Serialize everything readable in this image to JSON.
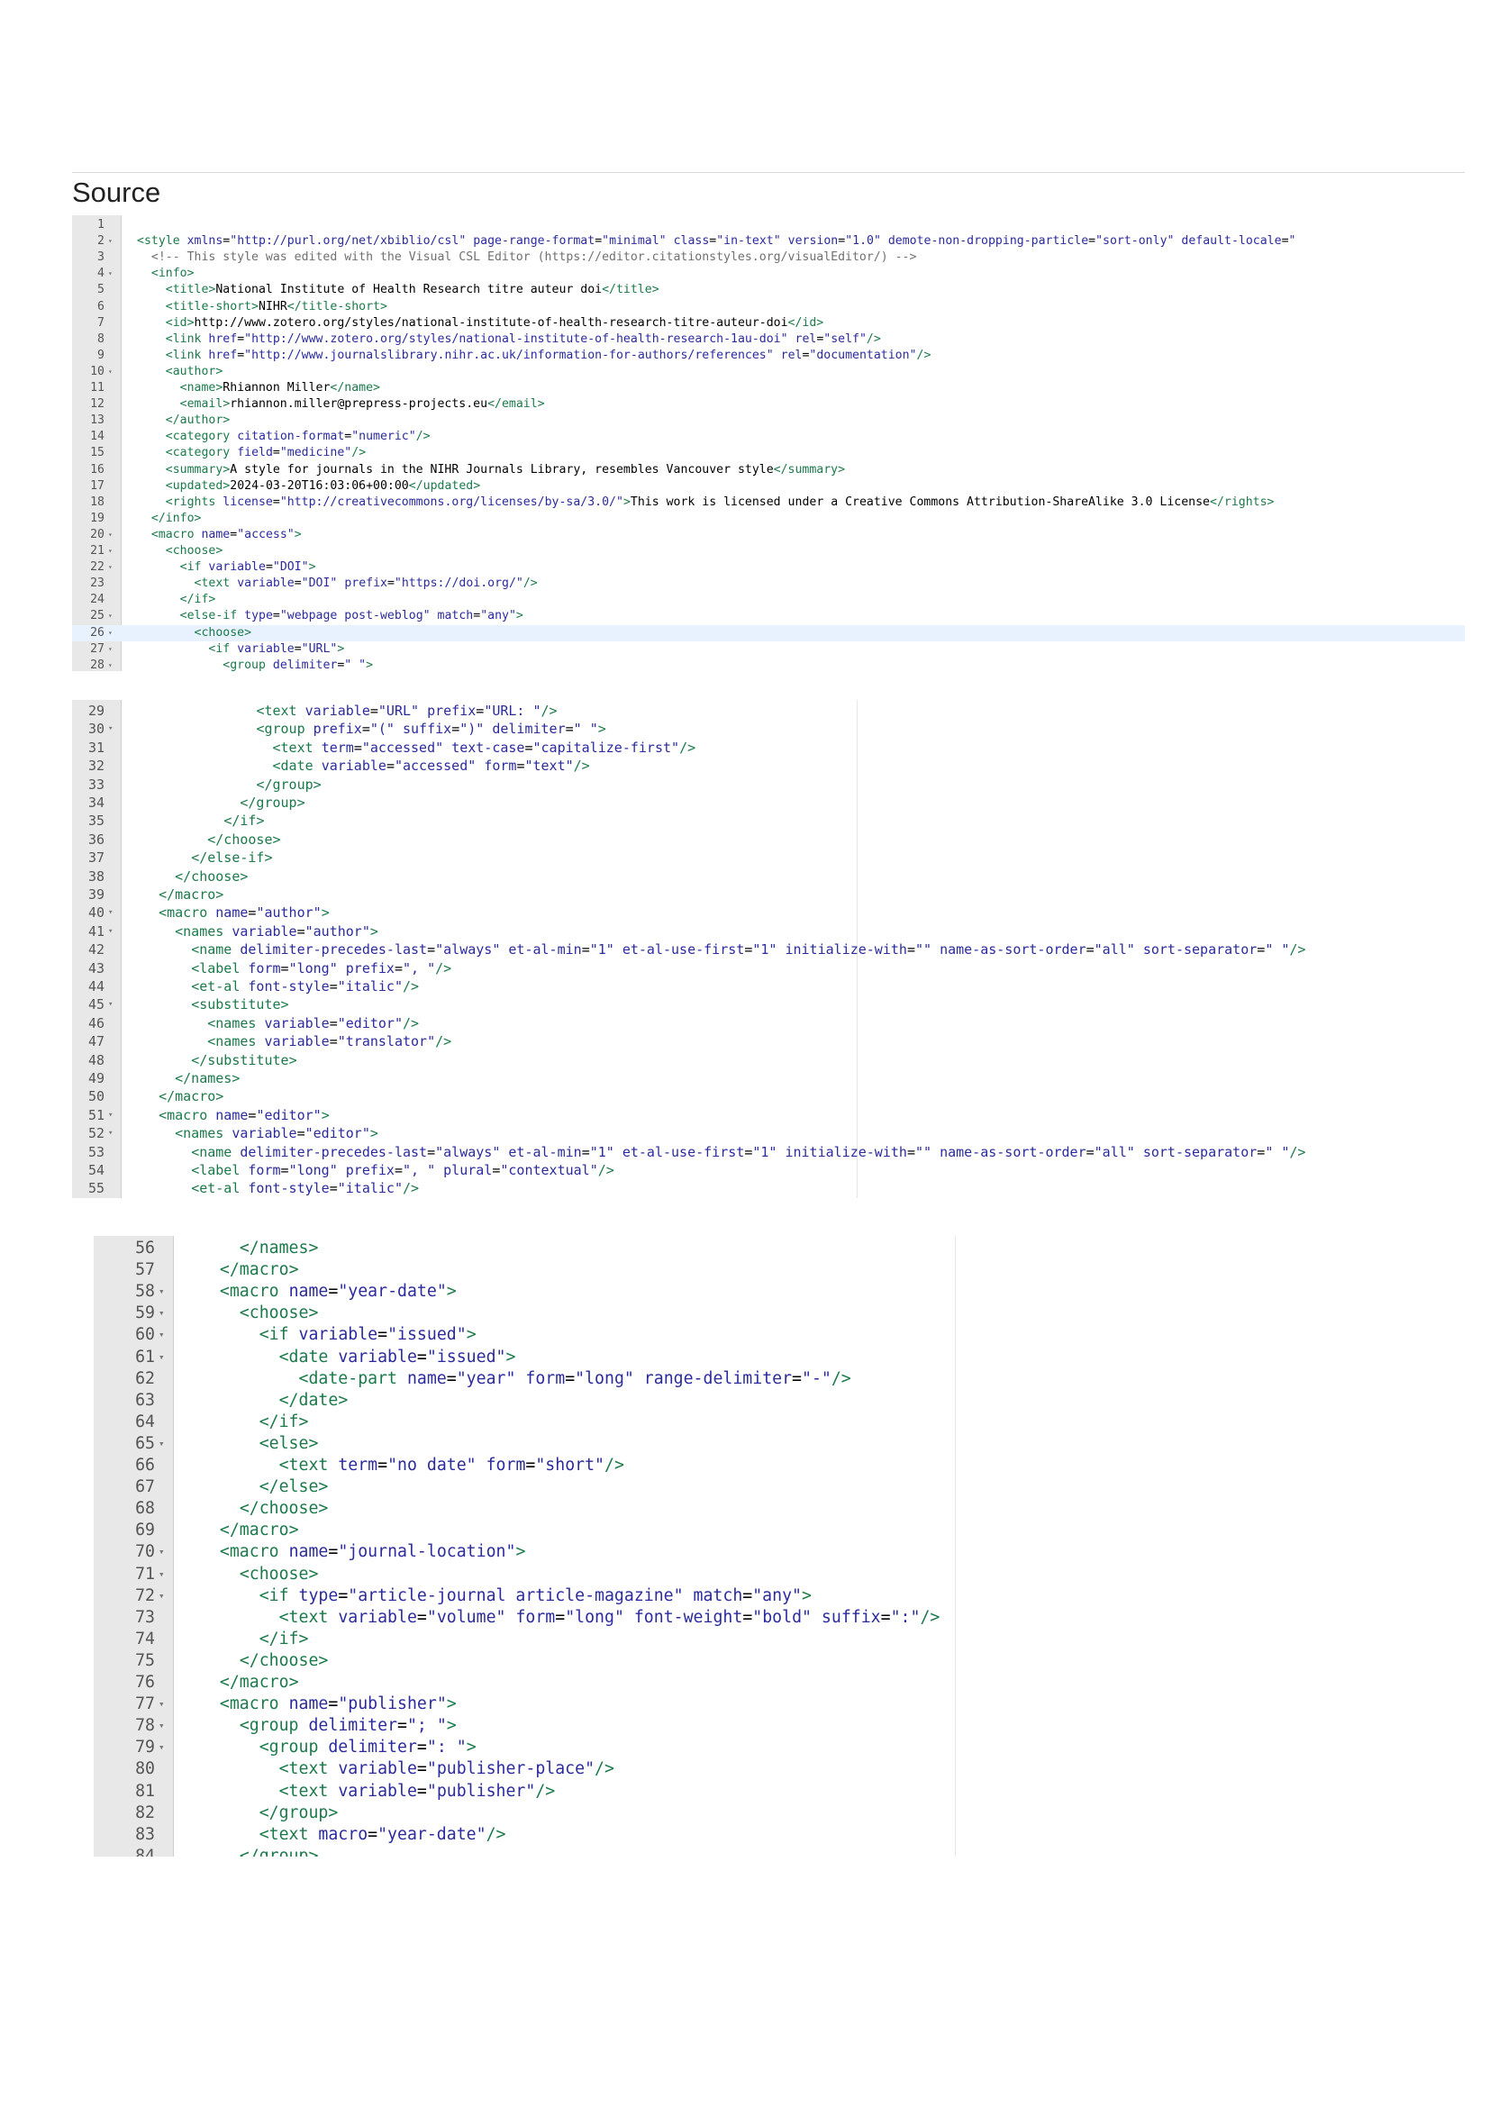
{
  "heading": "Source",
  "editors": [
    {
      "start": 1,
      "lines": [
        {
          "text": "",
          "fold": false
        },
        {
          "text": "<style xmlns=\"http://purl.org/net/xbiblio/csl\" page-range-format=\"minimal\" class=\"in-text\" version=\"1.0\" demote-non-dropping-particle=\"sort-only\" default-locale=\"",
          "fold": true
        },
        {
          "text": "  <!-- This style was edited with the Visual CSL Editor (https://editor.citationstyles.org/visualEditor/) -->",
          "fold": false
        },
        {
          "text": "  <info>",
          "fold": true
        },
        {
          "text": "    <title>National Institute of Health Research titre auteur doi</title>",
          "fold": false
        },
        {
          "text": "    <title-short>NIHR</title-short>",
          "fold": false
        },
        {
          "text": "    <id>http://www.zotero.org/styles/national-institute-of-health-research-titre-auteur-doi</id>",
          "fold": false
        },
        {
          "text": "    <link href=\"http://www.zotero.org/styles/national-institute-of-health-research-1au-doi\" rel=\"self\"/>",
          "fold": false
        },
        {
          "text": "    <link href=\"http://www.journalslibrary.nihr.ac.uk/information-for-authors/references\" rel=\"documentation\"/>",
          "fold": false
        },
        {
          "text": "    <author>",
          "fold": true
        },
        {
          "text": "      <name>Rhiannon Miller</name>",
          "fold": false
        },
        {
          "text": "      <email>rhiannon.miller@prepress-projects.eu</email>",
          "fold": false
        },
        {
          "text": "    </author>",
          "fold": false
        },
        {
          "text": "    <category citation-format=\"numeric\"/>",
          "fold": false
        },
        {
          "text": "    <category field=\"medicine\"/>",
          "fold": false
        },
        {
          "text": "    <summary>A style for journals in the NIHR Journals Library, resembles Vancouver style</summary>",
          "fold": false
        },
        {
          "text": "    <updated>2024-03-20T16:03:06+00:00</updated>",
          "fold": false
        },
        {
          "text": "    <rights license=\"http://creativecommons.org/licenses/by-sa/3.0/\">This work is licensed under a Creative Commons Attribution-ShareAlike 3.0 License</rights>",
          "fold": false
        },
        {
          "text": "  </info>",
          "fold": false
        },
        {
          "text": "  <macro name=\"access\">",
          "fold": true
        },
        {
          "text": "    <choose>",
          "fold": true
        },
        {
          "text": "      <if variable=\"DOI\">",
          "fold": true
        },
        {
          "text": "        <text variable=\"DOI\" prefix=\"https://doi.org/\"/>",
          "fold": false
        },
        {
          "text": "      </if>",
          "fold": false
        },
        {
          "text": "      <else-if type=\"webpage post-weblog\" match=\"any\">",
          "fold": true
        },
        {
          "text": "        <choose>",
          "fold": true,
          "active": true
        },
        {
          "text": "          <if variable=\"URL\">",
          "fold": true
        },
        {
          "text": "            <group delimiter=\" \">",
          "fold": true
        }
      ]
    },
    {
      "start": 29,
      "lines": [
        {
          "text": "              <text variable=\"URL\" prefix=\"URL: \"/>",
          "fold": false
        },
        {
          "text": "              <group prefix=\"(\" suffix=\")\" delimiter=\" \">",
          "fold": true
        },
        {
          "text": "                <text term=\"accessed\" text-case=\"capitalize-first\"/>",
          "fold": false
        },
        {
          "text": "                <date variable=\"accessed\" form=\"text\"/>",
          "fold": false
        },
        {
          "text": "              </group>",
          "fold": false
        },
        {
          "text": "            </group>",
          "fold": false
        },
        {
          "text": "          </if>",
          "fold": false
        },
        {
          "text": "        </choose>",
          "fold": false
        },
        {
          "text": "      </else-if>",
          "fold": false
        },
        {
          "text": "    </choose>",
          "fold": false
        },
        {
          "text": "  </macro>",
          "fold": false
        },
        {
          "text": "  <macro name=\"author\">",
          "fold": true
        },
        {
          "text": "    <names variable=\"author\">",
          "fold": true
        },
        {
          "text": "      <name delimiter-precedes-last=\"always\" et-al-min=\"1\" et-al-use-first=\"1\" initialize-with=\"\" name-as-sort-order=\"all\" sort-separator=\" \"/>",
          "fold": false
        },
        {
          "text": "      <label form=\"long\" prefix=\", \"/>",
          "fold": false
        },
        {
          "text": "      <et-al font-style=\"italic\"/>",
          "fold": false
        },
        {
          "text": "      <substitute>",
          "fold": true
        },
        {
          "text": "        <names variable=\"editor\"/>",
          "fold": false
        },
        {
          "text": "        <names variable=\"translator\"/>",
          "fold": false
        },
        {
          "text": "      </substitute>",
          "fold": false
        },
        {
          "text": "    </names>",
          "fold": false
        },
        {
          "text": "  </macro>",
          "fold": false
        },
        {
          "text": "  <macro name=\"editor\">",
          "fold": true
        },
        {
          "text": "    <names variable=\"editor\">",
          "fold": true
        },
        {
          "text": "      <name delimiter-precedes-last=\"always\" et-al-min=\"1\" et-al-use-first=\"1\" initialize-with=\"\" name-as-sort-order=\"all\" sort-separator=\" \"/>",
          "fold": false
        },
        {
          "text": "      <label form=\"long\" prefix=\", \" plural=\"contextual\"/>",
          "fold": false
        },
        {
          "text": "      <et-al font-style=\"italic\"/>",
          "fold": false
        }
      ]
    },
    {
      "start": 56,
      "lines": [
        {
          "text": "    </names>",
          "fold": false
        },
        {
          "text": "  </macro>",
          "fold": false
        },
        {
          "text": "  <macro name=\"year-date\">",
          "fold": true
        },
        {
          "text": "    <choose>",
          "fold": true
        },
        {
          "text": "      <if variable=\"issued\">",
          "fold": true
        },
        {
          "text": "        <date variable=\"issued\">",
          "fold": true
        },
        {
          "text": "          <date-part name=\"year\" form=\"long\" range-delimiter=\"-\"/>",
          "fold": false
        },
        {
          "text": "        </date>",
          "fold": false
        },
        {
          "text": "      </if>",
          "fold": false
        },
        {
          "text": "      <else>",
          "fold": true
        },
        {
          "text": "        <text term=\"no date\" form=\"short\"/>",
          "fold": false
        },
        {
          "text": "      </else>",
          "fold": false
        },
        {
          "text": "    </choose>",
          "fold": false
        },
        {
          "text": "  </macro>",
          "fold": false
        },
        {
          "text": "  <macro name=\"journal-location\">",
          "fold": true
        },
        {
          "text": "    <choose>",
          "fold": true
        },
        {
          "text": "      <if type=\"article-journal article-magazine\" match=\"any\">",
          "fold": true
        },
        {
          "text": "        <text variable=\"volume\" form=\"long\" font-weight=\"bold\" suffix=\":\"/>",
          "fold": false
        },
        {
          "text": "      </if>",
          "fold": false
        },
        {
          "text": "    </choose>",
          "fold": false
        },
        {
          "text": "  </macro>",
          "fold": false
        },
        {
          "text": "  <macro name=\"publisher\">",
          "fold": true
        },
        {
          "text": "    <group delimiter=\"; \">",
          "fold": true
        },
        {
          "text": "      <group delimiter=\": \">",
          "fold": true
        },
        {
          "text": "        <text variable=\"publisher-place\"/>",
          "fold": false
        },
        {
          "text": "        <text variable=\"publisher\"/>",
          "fold": false
        },
        {
          "text": "      </group>",
          "fold": false
        },
        {
          "text": "      <text macro=\"year-date\"/>",
          "fold": false
        },
        {
          "text": "    </group>",
          "fold": false
        }
      ]
    }
  ]
}
